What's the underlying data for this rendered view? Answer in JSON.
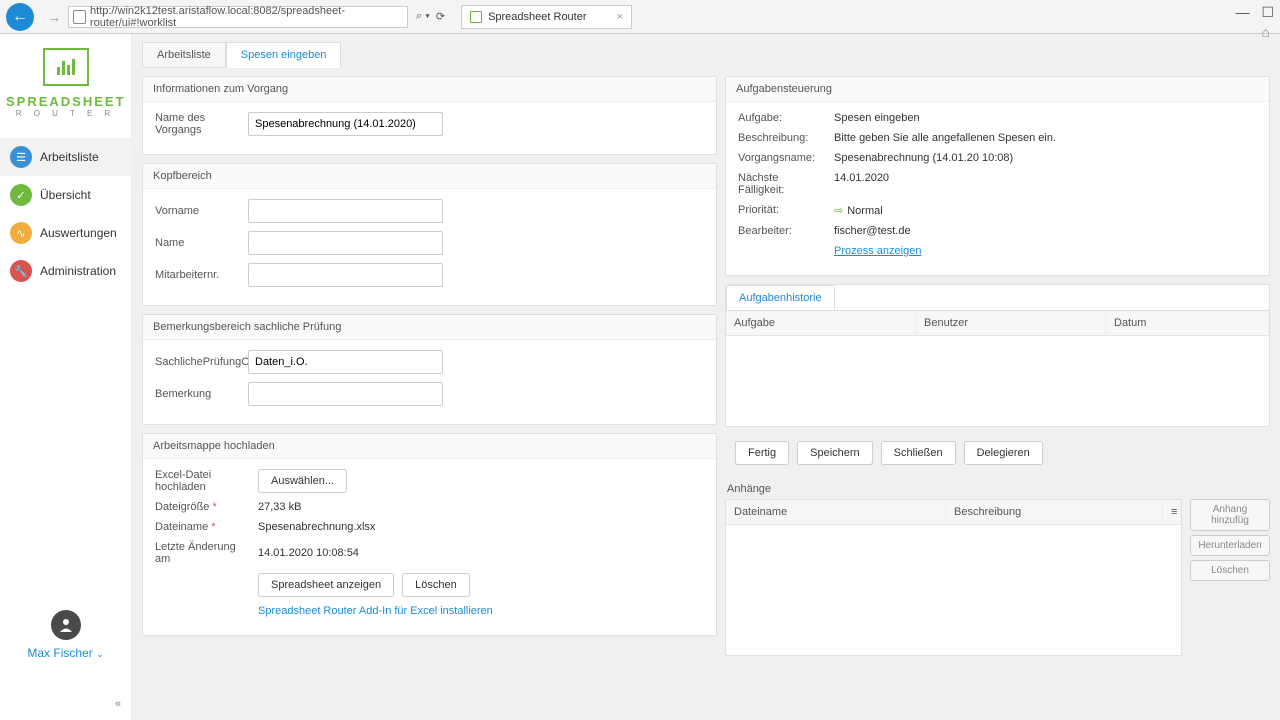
{
  "browser": {
    "url": "http://win2k12test.aristaflow.local:8082/spreadsheet-router/ui#!worklist",
    "tab_title": "Spreadsheet Router",
    "search_hint": "⌕ ▾"
  },
  "logo": {
    "l1": "SPREADSHEET",
    "l2": "R O U T E R"
  },
  "nav": [
    {
      "label": "Arbeitsliste"
    },
    {
      "label": "Übersicht"
    },
    {
      "label": "Auswertungen"
    },
    {
      "label": "Administration"
    }
  ],
  "user": {
    "name": "Max Fischer"
  },
  "tabs": [
    {
      "label": "Arbeitsliste"
    },
    {
      "label": "Spesen eingeben"
    }
  ],
  "panel_info": {
    "title": "Informationen zum Vorgang",
    "name_label": "Name des Vorgangs",
    "name_value": "Spesenabrechnung (14.01.2020)"
  },
  "panel_kopf": {
    "title": "Kopfbereich",
    "vorname": "Vorname",
    "name": "Name",
    "mitnr": "Mitarbeiternr."
  },
  "panel_bem": {
    "title": "Bemerkungsbereich sachliche Prüfung",
    "ok_label": "SachlichePrüfungOK",
    "ok_value": "Daten_i.O.",
    "bem_label": "Bemerkung"
  },
  "panel_upload": {
    "title": "Arbeitsmappe hochladen",
    "excel_label": "Excel-Datei hochladen",
    "choose": "Auswählen...",
    "size_label": "Dateigröße",
    "size_value": "27,33 kB",
    "fname_label": "Dateiname",
    "fname_value": "Spesenabrechnung.xlsx",
    "mod_label": "Letzte Änderung am",
    "mod_value": "14.01.2020 10:08:54",
    "btn_show": "Spreadsheet anzeigen",
    "btn_del": "Löschen",
    "addin_link": "Spreadsheet Router Add-In für Excel installieren"
  },
  "panel_task": {
    "title": "Aufgabensteuerung",
    "aufgabe_k": "Aufgabe:",
    "aufgabe_v": "Spesen eingeben",
    "besch_k": "Beschreibung:",
    "besch_v": "Bitte geben Sie alle angefallenen Spesen ein.",
    "vorg_k": "Vorgangsname:",
    "vorg_v": "Spesenabrechnung (14.01.20 10:08)",
    "due_k": "Nächste Fälligkeit:",
    "due_v": "14.01.2020",
    "prio_k": "Priorität:",
    "prio_v": "Normal",
    "bearb_k": "Bearbeiter:",
    "bearb_v": "fischer@test.de",
    "proc_link": "Prozess anzeigen"
  },
  "history": {
    "tab": "Aufgabenhistorie",
    "cols": [
      "Aufgabe",
      "Benutzer",
      "Datum"
    ]
  },
  "actions": {
    "fertig": "Fertig",
    "speichern": "Speichern",
    "schliessen": "Schließen",
    "delegieren": "Delegieren"
  },
  "attach": {
    "title": "Anhänge",
    "cols": [
      "Dateiname",
      "Beschreibung"
    ],
    "add": "Anhang hinzufüg",
    "download": "Herunterladen",
    "del": "Löschen"
  }
}
